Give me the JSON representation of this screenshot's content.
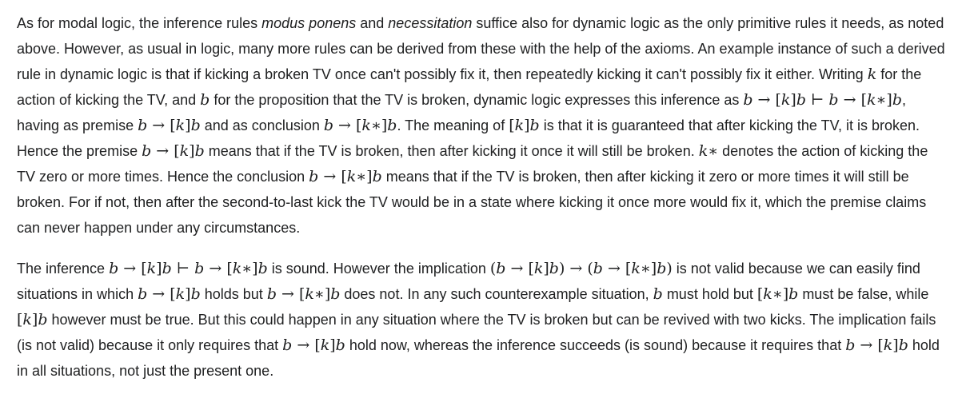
{
  "paragraphs": [
    {
      "segments": [
        {
          "t": "text",
          "v": "As for modal logic, the inference rules "
        },
        {
          "t": "em",
          "v": "modus ponens"
        },
        {
          "t": "text",
          "v": " and "
        },
        {
          "t": "em",
          "v": "necessitation"
        },
        {
          "t": "text",
          "v": " suffice also for dynamic logic as the only primitive rules it needs, as noted above. However, as usual in logic, many more rules can be derived from these with the help of the axioms. An example instance of such a derived rule in dynamic logic is that if kicking a broken TV once can't possibly fix it, then repeatedly kicking it can't possibly fix it either. Writing "
        },
        {
          "t": "math",
          "v": "𝑘"
        },
        {
          "t": "text",
          "v": " for the action of kicking the TV, and "
        },
        {
          "t": "math",
          "v": "𝑏"
        },
        {
          "t": "text",
          "v": " for the proposition that the TV is broken, dynamic logic expresses this inference as "
        },
        {
          "t": "math",
          "v": "𝑏 → [𝑘]𝑏 ⊢ 𝑏 → [𝑘∗]𝑏"
        },
        {
          "t": "text",
          "v": ", having as premise "
        },
        {
          "t": "math",
          "v": "𝑏 → [𝑘]𝑏"
        },
        {
          "t": "text",
          "v": " and as conclusion "
        },
        {
          "t": "math",
          "v": "𝑏 → [𝑘∗]𝑏"
        },
        {
          "t": "text",
          "v": ". The meaning of "
        },
        {
          "t": "math",
          "v": "[𝑘]𝑏"
        },
        {
          "t": "text",
          "v": " is that it is guaranteed that after kicking the TV, it is broken. Hence the premise "
        },
        {
          "t": "math",
          "v": "𝑏 → [𝑘]𝑏"
        },
        {
          "t": "text",
          "v": " means that if the TV is broken, then after kicking it once it will still be broken. "
        },
        {
          "t": "math",
          "v": "𝑘∗"
        },
        {
          "t": "text",
          "v": " denotes the action of kicking the TV zero or more times. Hence the conclusion "
        },
        {
          "t": "math",
          "v": "𝑏 → [𝑘∗]𝑏"
        },
        {
          "t": "text",
          "v": " means that if the TV is broken, then after kicking it zero or more times it will still be broken. For if not, then after the second-to-last kick the TV would be in a state where kicking it once more would fix it, which the premise claims can never happen under any circumstances."
        }
      ]
    },
    {
      "segments": [
        {
          "t": "text",
          "v": "The inference "
        },
        {
          "t": "math",
          "v": "𝑏 → [𝑘]𝑏 ⊢ 𝑏 → [𝑘∗]𝑏"
        },
        {
          "t": "text",
          "v": " is sound. However the implication "
        },
        {
          "t": "math",
          "v": "(𝑏 → [𝑘]𝑏) → (𝑏 → [𝑘∗]𝑏)"
        },
        {
          "t": "text",
          "v": " is not valid because we can easily find situations in which "
        },
        {
          "t": "math",
          "v": "𝑏 → [𝑘]𝑏"
        },
        {
          "t": "text",
          "v": " holds but "
        },
        {
          "t": "math",
          "v": "𝑏 → [𝑘∗]𝑏"
        },
        {
          "t": "text",
          "v": " does not. In any such counterexample situation, "
        },
        {
          "t": "math",
          "v": "𝑏"
        },
        {
          "t": "text",
          "v": " must hold but "
        },
        {
          "t": "math",
          "v": "[𝑘∗]𝑏"
        },
        {
          "t": "text",
          "v": " must be false, while "
        },
        {
          "t": "math",
          "v": "[𝑘]𝑏"
        },
        {
          "t": "text",
          "v": " however must be true. But this could happen in any situation where the TV is broken but can be revived with two kicks. The implication fails (is not valid) because it only requires that "
        },
        {
          "t": "math",
          "v": "𝑏 → [𝑘]𝑏"
        },
        {
          "t": "text",
          "v": " hold now, whereas the inference succeeds (is sound) because it requires that "
        },
        {
          "t": "math",
          "v": "𝑏 → [𝑘]𝑏"
        },
        {
          "t": "text",
          "v": " hold in all situations, not just the present one."
        }
      ]
    }
  ]
}
